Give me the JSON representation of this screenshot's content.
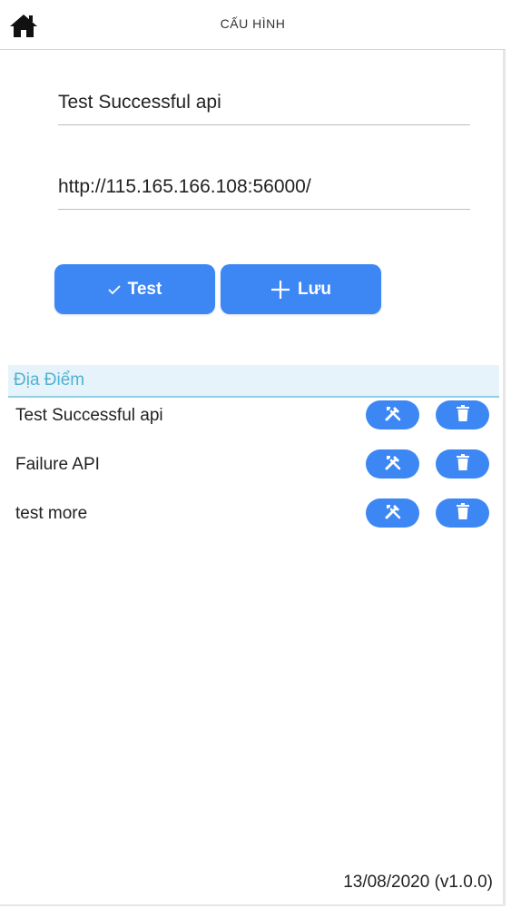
{
  "header": {
    "title": "CẤU HÌNH",
    "home_icon": "home-icon"
  },
  "form": {
    "name_value": "Test Successful api",
    "url_value": "http://115.165.166.108:56000/"
  },
  "buttons": {
    "test_label": "Test",
    "save_label": "Lưu"
  },
  "section": {
    "title": "Địa Điểm"
  },
  "locations": [
    {
      "name": "Test Successful api"
    },
    {
      "name": "Failure API"
    },
    {
      "name": "test more"
    }
  ],
  "footer": {
    "version": "13/08/2020 (v1.0.0)"
  },
  "colors": {
    "accent": "#3d87f5",
    "section_bg": "#e6f3fb",
    "section_text": "#4fb3cf"
  }
}
